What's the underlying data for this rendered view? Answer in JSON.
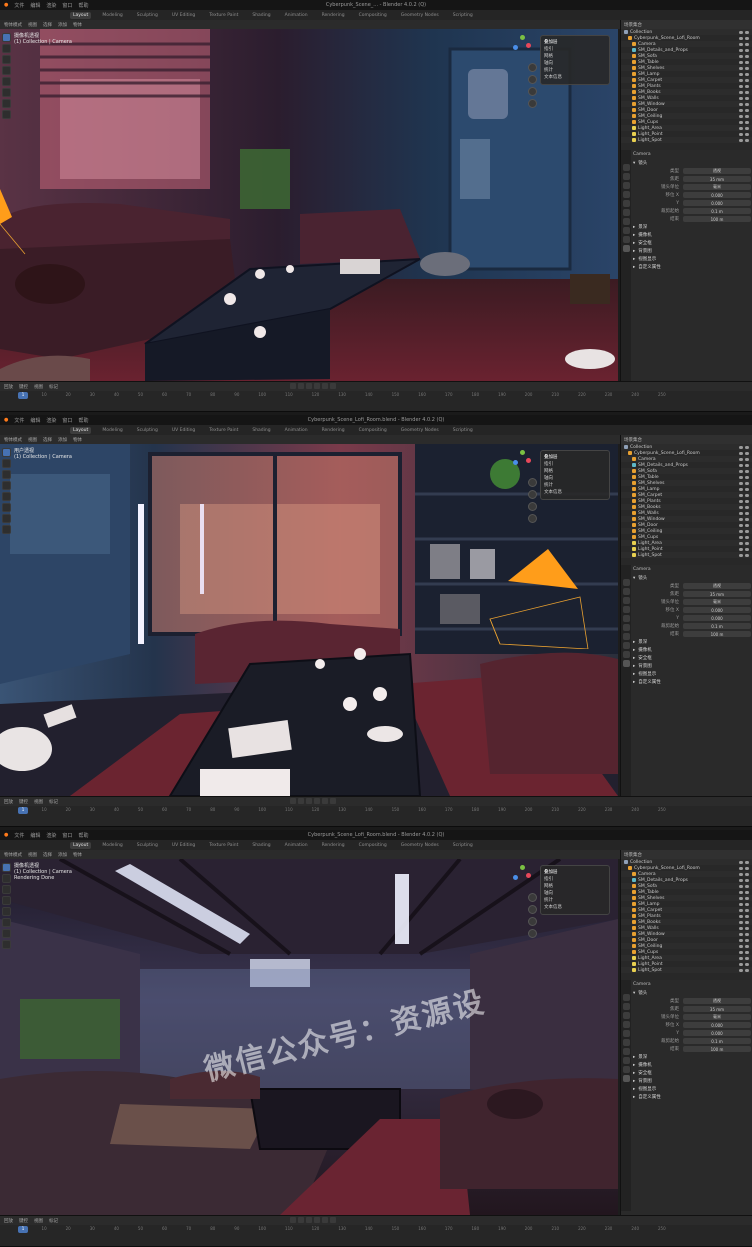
{
  "panels": [
    {
      "window_title": "Cyberpunk_Scene_... - Blender 4.0.2 (Q)",
      "menus": [
        "文件",
        "编辑",
        "渲染",
        "窗口",
        "帮助"
      ],
      "workspaces": [
        "Layout",
        "Modeling",
        "Sculpting",
        "UV Editing",
        "Texture Paint",
        "Shading",
        "Animation",
        "Rendering",
        "Compositing",
        "Geometry Nodes",
        "Scripting"
      ],
      "active_workspace": "Layout",
      "viewport_header": [
        "物体模式",
        "视图",
        "选择",
        "添加",
        "物体"
      ],
      "viewport_text": [
        "摄像机透视",
        "(1) Collection | Camera"
      ],
      "popup": {
        "title": "叠加层",
        "items": [
          "指引",
          "网格",
          "轴向",
          "统计",
          "文本信息"
        ]
      },
      "frame_start": 1,
      "frame_current": 1
    },
    {
      "window_title": "Cyberpunk_Scene_Lofi_Room.blend - Blender 4.0.2 (Q)",
      "menus": [
        "文件",
        "编辑",
        "渲染",
        "窗口",
        "帮助"
      ],
      "workspaces": [
        "Layout",
        "Modeling",
        "Sculpting",
        "UV Editing",
        "Texture Paint",
        "Shading",
        "Animation",
        "Rendering",
        "Compositing",
        "Geometry Nodes",
        "Scripting"
      ],
      "active_workspace": "Layout",
      "viewport_header": [
        "物体模式",
        "视图",
        "选择",
        "添加",
        "物体"
      ],
      "viewport_text": [
        "用户透视",
        "(1) Collection | Camera"
      ],
      "popup": {
        "title": "叠加层",
        "items": [
          "指引",
          "网格",
          "轴向",
          "统计",
          "文本信息"
        ]
      },
      "frame_start": 1,
      "frame_current": 1
    },
    {
      "window_title": "Cyberpunk_Scene_Lofi_Room.blend - Blender 4.0.2 (Q)",
      "menus": [
        "文件",
        "编辑",
        "渲染",
        "窗口",
        "帮助"
      ],
      "workspaces": [
        "Layout",
        "Modeling",
        "Sculpting",
        "UV Editing",
        "Texture Paint",
        "Shading",
        "Animation",
        "Rendering",
        "Compositing",
        "Geometry Nodes",
        "Scripting"
      ],
      "active_workspace": "Layout",
      "viewport_header": [
        "物体模式",
        "视图",
        "选择",
        "添加",
        "物体"
      ],
      "viewport_text": [
        "摄像机透视",
        "(1) Collection | Camera",
        "Rendering Done"
      ],
      "popup": {
        "title": "叠加层",
        "items": [
          "指引",
          "网格",
          "轴向",
          "统计",
          "文本信息"
        ]
      },
      "frame_start": 1,
      "frame_current": 1
    }
  ],
  "watermark_text": "微信公众号：资源设",
  "outliner": {
    "title": "场景集合",
    "rows": [
      "Collection",
      "Cyberpunk_Scene_Lofi_Room",
      "Camera",
      "SM_Details_and_Props",
      "SM_Sofa",
      "SM_Table",
      "SM_Shelves",
      "SM_Lamp",
      "SM_Carpet",
      "SM_Plants",
      "SM_Books",
      "SM_Walls",
      "SM_Window",
      "SM_Door",
      "SM_Ceiling",
      "SM_Cups",
      "Light_Area",
      "Light_Point",
      "Light_Spot"
    ]
  },
  "properties": {
    "tab_title": "Camera",
    "section_lens": "镜头",
    "rows": [
      {
        "label": "类型",
        "value": "透视"
      },
      {
        "label": "焦距",
        "value": "35 mm"
      },
      {
        "label": "镜头单位",
        "value": "毫米"
      },
      {
        "label": "移位 X",
        "value": "0.000"
      },
      {
        "label": "Y",
        "value": "0.000"
      },
      {
        "label": "裁剪起始",
        "value": "0.1 m"
      },
      {
        "label": "结束",
        "value": "100 m"
      }
    ],
    "sections": [
      "景深",
      "摄像机",
      "安全框",
      "背景图",
      "视图显示",
      "自定义属性"
    ]
  },
  "timeline": {
    "labels": [
      "回放",
      "键控",
      "视图",
      "标记"
    ],
    "frames": [
      "0",
      "10",
      "20",
      "30",
      "40",
      "50",
      "60",
      "70",
      "80",
      "90",
      "100",
      "110",
      "120",
      "130",
      "140",
      "150",
      "160",
      "170",
      "180",
      "190",
      "200",
      "210",
      "220",
      "230",
      "240",
      "250"
    ]
  },
  "colors": {
    "accent": "#4772b3",
    "camera_cone": "#ff9d1a",
    "bg_panel": "#2a2a2a"
  }
}
